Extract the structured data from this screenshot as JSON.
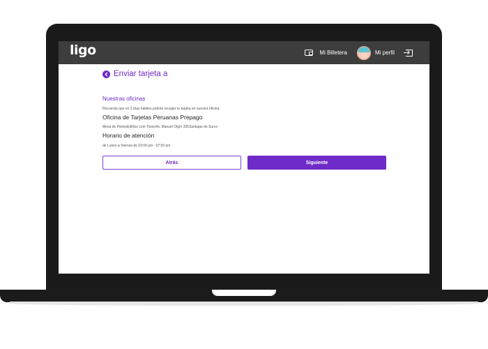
{
  "header": {
    "logo": "ligo",
    "wallet_label": "Mi Billetera",
    "profile_label": "Mi perfil"
  },
  "page": {
    "title": "Enviar tarjeta a"
  },
  "offices": {
    "section_title": "Nuestras oficinas",
    "note": "Recuerda que en 3 días hábiles podrás recoger tu tarjeta en nuestra oficina.",
    "office_name": "Oficina de Tarjetas Peruanas Prepago",
    "address": "Mesa de PartesEdificio Link TowerAv. Manuel Olgín 335Santiago de Surco",
    "hours_title": "Horario de atención",
    "hours": "de Lunes a Viernes de 02:00 pm - 07:00 pm"
  },
  "actions": {
    "back_label": "Atrás",
    "next_label": "Siguiente"
  },
  "colors": {
    "accent": "#6f2bc7",
    "header_bg": "#3d3d3d",
    "laptop_frame": "#1a1a1a"
  },
  "icons": [
    "wallet-icon",
    "avatar",
    "logout-icon",
    "back-arrow-icon"
  ]
}
